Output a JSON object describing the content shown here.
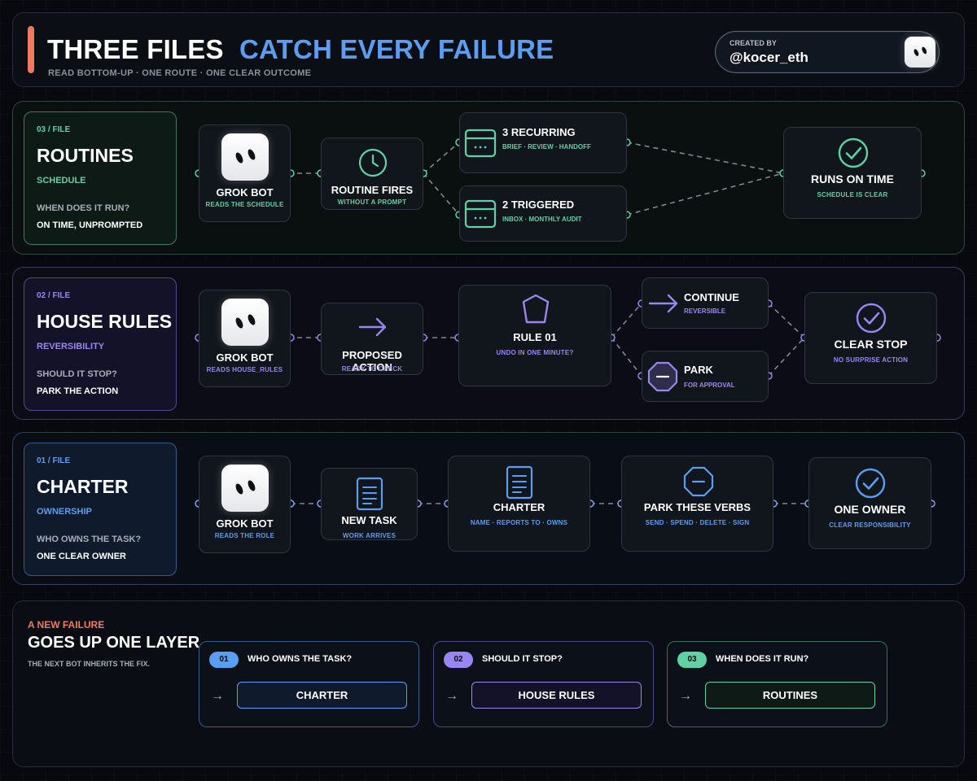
{
  "header": {
    "title_white": "THREE FILES",
    "title_blue": "CATCH EVERY FAILURE",
    "subtitle": "READ BOTTOM-UP · ONE ROUTE · ONE CLEAR OUTCOME",
    "creator_label": "CREATED BY",
    "creator_handle": "@kocer_eth"
  },
  "colors": {
    "accent_orange": "#ef7a5e",
    "blue": "#5b9df0",
    "green": "#5fd1a5",
    "purple": "#9a86f0"
  },
  "rows": {
    "routines": {
      "file_num": "03 / FILE",
      "name": "ROUTINES",
      "tag": "SCHEDULE",
      "question": "WHEN DOES IT RUN?",
      "answer": "ON TIME, UNPROMPTED",
      "bot": {
        "title": "GROK BOT",
        "sub": "READS THE SCHEDULE"
      },
      "trigger": {
        "title": "ROUTINE FIRES",
        "sub": "WITHOUT A PROMPT",
        "icon": "clock-icon"
      },
      "branch_a": {
        "title": "3 RECURRING",
        "sub": "BRIEF · REVIEW · HANDOFF",
        "icon": "window-icon"
      },
      "branch_b": {
        "title": "2 TRIGGERED",
        "sub": "INBOX · MONTHLY AUDIT",
        "icon": "window-icon"
      },
      "result": {
        "title": "RUNS ON TIME",
        "sub": "SCHEDULE IS CLEAR",
        "icon": "check-circle-icon"
      }
    },
    "house_rules": {
      "file_num": "02 / FILE",
      "name": "HOUSE RULES",
      "tag": "REVERSIBILITY",
      "question": "SHOULD IT STOP?",
      "answer": "PARK THE ACTION",
      "bot": {
        "title": "GROK BOT",
        "sub": "READS HOUSE_RULES"
      },
      "action": {
        "title": "PROPOSED ACTION",
        "sub": "READY TO CHECK",
        "icon": "arrow-right-icon"
      },
      "rule": {
        "title": "RULE 01",
        "sub": "UNDO IN ONE MINUTE?",
        "icon": "shield-icon"
      },
      "branch_a": {
        "title": "CONTINUE",
        "sub": "REVERSIBLE",
        "icon": "arrow-right-icon"
      },
      "branch_b": {
        "title": "PARK",
        "sub": "FOR APPROVAL",
        "icon": "stop-octagon-icon"
      },
      "result": {
        "title": "CLEAR STOP",
        "sub": "NO SURPRISE ACTION",
        "icon": "check-circle-icon"
      }
    },
    "charter": {
      "file_num": "01 / FILE",
      "name": "CHARTER",
      "tag": "OWNERSHIP",
      "question": "WHO OWNS THE TASK?",
      "answer": "ONE CLEAR OWNER",
      "bot": {
        "title": "GROK BOT",
        "sub": "READS THE ROLE"
      },
      "task": {
        "title": "NEW TASK",
        "sub": "WORK ARRIVES",
        "icon": "document-icon"
      },
      "charter_node": {
        "title": "CHARTER",
        "sub": "NAME · REPORTS TO · OWNS",
        "icon": "document-icon"
      },
      "verbs": {
        "title": "PARK THESE VERBS",
        "sub": "SEND · SPEND · DELETE · SIGN",
        "icon": "stop-octagon-icon"
      },
      "result": {
        "title": "ONE OWNER",
        "sub": "CLEAR RESPONSIBILITY",
        "icon": "check-circle-icon"
      }
    }
  },
  "bottom": {
    "eyebrow": "A NEW FAILURE",
    "title": "GOES UP ONE LAYER.",
    "subtitle": "THE NEXT BOT INHERITS THE FIX.",
    "arrow": "→",
    "cards": [
      {
        "num": "01",
        "question": "WHO OWNS THE TASK?",
        "file": "CHARTER"
      },
      {
        "num": "02",
        "question": "SHOULD IT STOP?",
        "file": "HOUSE RULES"
      },
      {
        "num": "03",
        "question": "WHEN DOES IT RUN?",
        "file": "ROUTINES"
      }
    ]
  }
}
